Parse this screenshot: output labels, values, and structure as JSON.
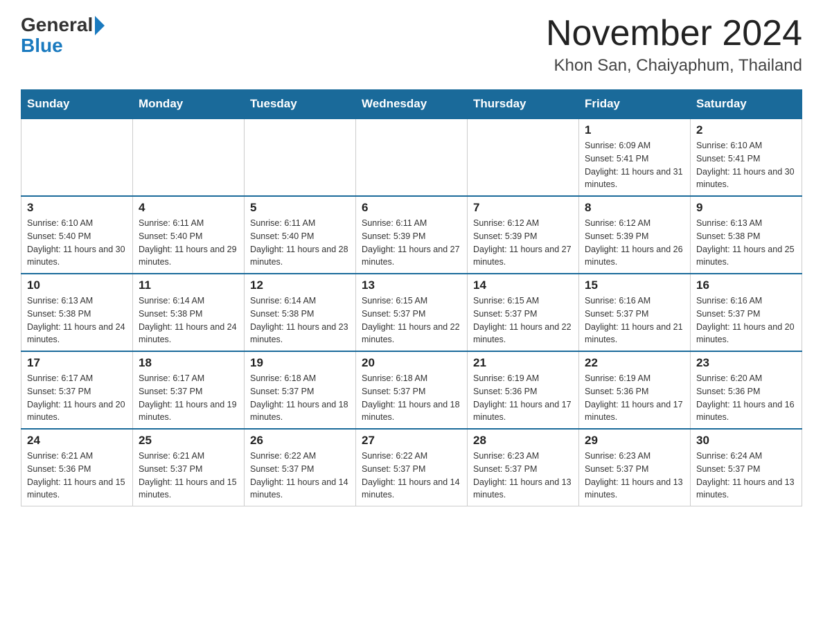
{
  "header": {
    "logo_general": "General",
    "logo_blue": "Blue",
    "month_title": "November 2024",
    "location": "Khon San, Chaiyaphum, Thailand"
  },
  "weekdays": [
    "Sunday",
    "Monday",
    "Tuesday",
    "Wednesday",
    "Thursday",
    "Friday",
    "Saturday"
  ],
  "weeks": [
    [
      {
        "day": "",
        "info": ""
      },
      {
        "day": "",
        "info": ""
      },
      {
        "day": "",
        "info": ""
      },
      {
        "day": "",
        "info": ""
      },
      {
        "day": "",
        "info": ""
      },
      {
        "day": "1",
        "info": "Sunrise: 6:09 AM\nSunset: 5:41 PM\nDaylight: 11 hours and 31 minutes."
      },
      {
        "day": "2",
        "info": "Sunrise: 6:10 AM\nSunset: 5:41 PM\nDaylight: 11 hours and 30 minutes."
      }
    ],
    [
      {
        "day": "3",
        "info": "Sunrise: 6:10 AM\nSunset: 5:40 PM\nDaylight: 11 hours and 30 minutes."
      },
      {
        "day": "4",
        "info": "Sunrise: 6:11 AM\nSunset: 5:40 PM\nDaylight: 11 hours and 29 minutes."
      },
      {
        "day": "5",
        "info": "Sunrise: 6:11 AM\nSunset: 5:40 PM\nDaylight: 11 hours and 28 minutes."
      },
      {
        "day": "6",
        "info": "Sunrise: 6:11 AM\nSunset: 5:39 PM\nDaylight: 11 hours and 27 minutes."
      },
      {
        "day": "7",
        "info": "Sunrise: 6:12 AM\nSunset: 5:39 PM\nDaylight: 11 hours and 27 minutes."
      },
      {
        "day": "8",
        "info": "Sunrise: 6:12 AM\nSunset: 5:39 PM\nDaylight: 11 hours and 26 minutes."
      },
      {
        "day": "9",
        "info": "Sunrise: 6:13 AM\nSunset: 5:38 PM\nDaylight: 11 hours and 25 minutes."
      }
    ],
    [
      {
        "day": "10",
        "info": "Sunrise: 6:13 AM\nSunset: 5:38 PM\nDaylight: 11 hours and 24 minutes."
      },
      {
        "day": "11",
        "info": "Sunrise: 6:14 AM\nSunset: 5:38 PM\nDaylight: 11 hours and 24 minutes."
      },
      {
        "day": "12",
        "info": "Sunrise: 6:14 AM\nSunset: 5:38 PM\nDaylight: 11 hours and 23 minutes."
      },
      {
        "day": "13",
        "info": "Sunrise: 6:15 AM\nSunset: 5:37 PM\nDaylight: 11 hours and 22 minutes."
      },
      {
        "day": "14",
        "info": "Sunrise: 6:15 AM\nSunset: 5:37 PM\nDaylight: 11 hours and 22 minutes."
      },
      {
        "day": "15",
        "info": "Sunrise: 6:16 AM\nSunset: 5:37 PM\nDaylight: 11 hours and 21 minutes."
      },
      {
        "day": "16",
        "info": "Sunrise: 6:16 AM\nSunset: 5:37 PM\nDaylight: 11 hours and 20 minutes."
      }
    ],
    [
      {
        "day": "17",
        "info": "Sunrise: 6:17 AM\nSunset: 5:37 PM\nDaylight: 11 hours and 20 minutes."
      },
      {
        "day": "18",
        "info": "Sunrise: 6:17 AM\nSunset: 5:37 PM\nDaylight: 11 hours and 19 minutes."
      },
      {
        "day": "19",
        "info": "Sunrise: 6:18 AM\nSunset: 5:37 PM\nDaylight: 11 hours and 18 minutes."
      },
      {
        "day": "20",
        "info": "Sunrise: 6:18 AM\nSunset: 5:37 PM\nDaylight: 11 hours and 18 minutes."
      },
      {
        "day": "21",
        "info": "Sunrise: 6:19 AM\nSunset: 5:36 PM\nDaylight: 11 hours and 17 minutes."
      },
      {
        "day": "22",
        "info": "Sunrise: 6:19 AM\nSunset: 5:36 PM\nDaylight: 11 hours and 17 minutes."
      },
      {
        "day": "23",
        "info": "Sunrise: 6:20 AM\nSunset: 5:36 PM\nDaylight: 11 hours and 16 minutes."
      }
    ],
    [
      {
        "day": "24",
        "info": "Sunrise: 6:21 AM\nSunset: 5:36 PM\nDaylight: 11 hours and 15 minutes."
      },
      {
        "day": "25",
        "info": "Sunrise: 6:21 AM\nSunset: 5:37 PM\nDaylight: 11 hours and 15 minutes."
      },
      {
        "day": "26",
        "info": "Sunrise: 6:22 AM\nSunset: 5:37 PM\nDaylight: 11 hours and 14 minutes."
      },
      {
        "day": "27",
        "info": "Sunrise: 6:22 AM\nSunset: 5:37 PM\nDaylight: 11 hours and 14 minutes."
      },
      {
        "day": "28",
        "info": "Sunrise: 6:23 AM\nSunset: 5:37 PM\nDaylight: 11 hours and 13 minutes."
      },
      {
        "day": "29",
        "info": "Sunrise: 6:23 AM\nSunset: 5:37 PM\nDaylight: 11 hours and 13 minutes."
      },
      {
        "day": "30",
        "info": "Sunrise: 6:24 AM\nSunset: 5:37 PM\nDaylight: 11 hours and 13 minutes."
      }
    ]
  ]
}
